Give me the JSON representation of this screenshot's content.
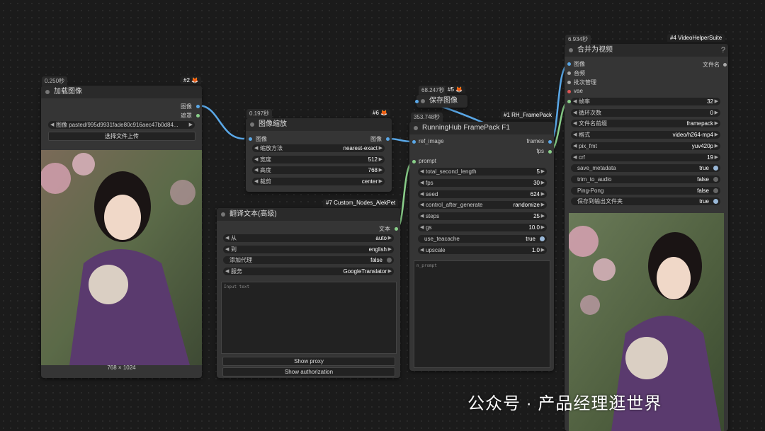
{
  "colors": {
    "image_wire": "#5aa8e8",
    "string_wire": "#8ad08a",
    "node_bg": "#353535",
    "header_bg": "#2a2a2a"
  },
  "load_image": {
    "time": "0.250秒",
    "tag": "#2",
    "title": "加载图像",
    "out_image": "图像",
    "out_mask": "遮罩",
    "image_value": "图像 pasted/995d9931fade80c916aec47b0d84...",
    "upload_button": "选择文件上传",
    "dims": "768 × 1024"
  },
  "scale": {
    "time": "0.197秒",
    "tag": "#6",
    "title": "图像缩放",
    "in_image": "图像",
    "out_image": "图像",
    "widgets": [
      {
        "label": "缩放方法",
        "value": "nearest-exact"
      },
      {
        "label": "宽度",
        "value": "512"
      },
      {
        "label": "高度",
        "value": "768"
      },
      {
        "label": "裁剪",
        "value": "center"
      }
    ]
  },
  "translate": {
    "tag": "#7 Custom_Nodes_AlekPet",
    "title": "翻译文本(高级)",
    "out_text": "文本",
    "widgets": [
      {
        "label": "从",
        "value": "auto"
      },
      {
        "label": "到",
        "value": "english"
      },
      {
        "label": "添加代理",
        "value": "false"
      },
      {
        "label": "服务",
        "value": "GoogleTranslator"
      }
    ],
    "placeholder": "Input text",
    "show_proxy": "Show proxy",
    "show_auth": "Show authorization"
  },
  "save_image": {
    "time": "68.247秒",
    "tag": "#5",
    "title": "保存图像"
  },
  "framepack": {
    "time": "353.748秒",
    "tag": "#1 RH_FramePack",
    "title": "RunningHub FramePack F1",
    "in_ref": "ref_image",
    "in_prompt": "prompt",
    "out_frames": "frames",
    "out_fps": "fps",
    "widgets": [
      {
        "label": "total_second_length",
        "value": "5"
      },
      {
        "label": "fps",
        "value": "30"
      },
      {
        "label": "seed",
        "value": "624"
      },
      {
        "label": "control_after_generate",
        "value": "randomize"
      },
      {
        "label": "steps",
        "value": "25"
      },
      {
        "label": "gs",
        "value": "10.0"
      },
      {
        "label": "use_teacache",
        "value": "true"
      },
      {
        "label": "upscale",
        "value": "1.0"
      }
    ],
    "prompt_placeholder": "n_prompt"
  },
  "combine": {
    "time": "6.934秒",
    "tag": "#4 VideoHelperSuite",
    "title": "合并为视频",
    "help": "?",
    "inputs": [
      "图像",
      "音频",
      "批次管理",
      "vae"
    ],
    "out_filename": "文件名",
    "widgets": [
      {
        "label": "帧率",
        "value": "32"
      },
      {
        "label": "循环次数",
        "value": "0"
      },
      {
        "label": "文件名前缀",
        "value": "framepack"
      },
      {
        "label": "格式",
        "value": "video/h264-mp4"
      },
      {
        "label": "pix_fmt",
        "value": "yuv420p"
      },
      {
        "label": "crf",
        "value": "19"
      },
      {
        "label": "save_metadata",
        "value": "true"
      },
      {
        "label": "trim_to_audio",
        "value": "false"
      },
      {
        "label": "Ping-Pong",
        "value": "false"
      },
      {
        "label": "保存到输出文件夹",
        "value": "true"
      }
    ]
  },
  "watermark": "公众号 · 产品经理逛世界"
}
